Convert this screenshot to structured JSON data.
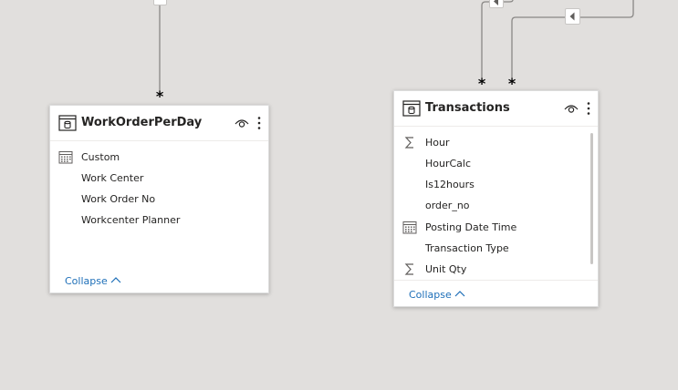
{
  "relationships": {
    "many_marker": "*"
  },
  "tables": [
    {
      "name": "WorkOrderPerDay",
      "icon": "table-icon",
      "fields": [
        {
          "label": "Custom",
          "icon": "calendar-icon"
        },
        {
          "label": "Work Center",
          "icon": ""
        },
        {
          "label": "Work Order No",
          "icon": ""
        },
        {
          "label": "Workcenter Planner",
          "icon": ""
        }
      ],
      "collapse_label": "Collapse"
    },
    {
      "name": "Transactions",
      "icon": "table-icon",
      "fields": [
        {
          "label": "Hour",
          "icon": "sigma-icon"
        },
        {
          "label": "HourCalc",
          "icon": ""
        },
        {
          "label": "Is12hours",
          "icon": ""
        },
        {
          "label": "order_no",
          "icon": ""
        },
        {
          "label": "Posting Date Time",
          "icon": "calendar-icon"
        },
        {
          "label": "Transaction Type",
          "icon": ""
        },
        {
          "label": "Unit Qty",
          "icon": "sigma-icon"
        }
      ],
      "collapse_label": "Collapse"
    }
  ],
  "colors": {
    "canvas": "#e1dfdd",
    "link": "#1e6fb8",
    "line": "#8a8886"
  }
}
